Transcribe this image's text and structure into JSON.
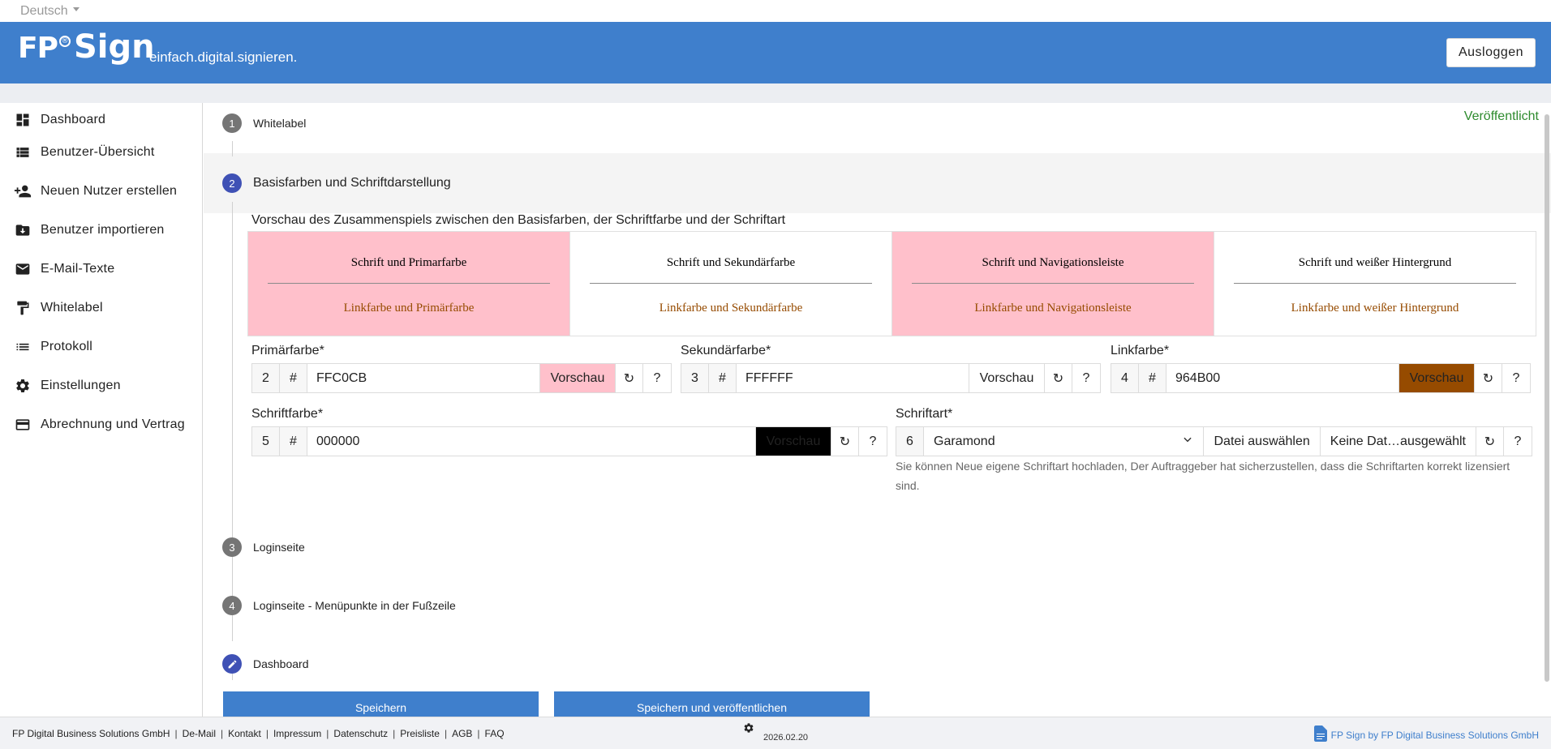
{
  "lang": {
    "label": "Deutsch"
  },
  "header": {
    "logo_fp": "FP",
    "logo_mark": "®",
    "logo_sign": "Sign",
    "tagline": "einfach.digital.signieren.",
    "logout": "Ausloggen"
  },
  "sidebar": {
    "items": [
      {
        "label": "Dashboard",
        "icon": "dashboard-icon"
      },
      {
        "label": "Benutzer-Übersicht",
        "icon": "list-icon"
      },
      {
        "label": "Neuen Nutzer erstellen",
        "icon": "person-add-icon"
      },
      {
        "label": "Benutzer importieren",
        "icon": "import-icon"
      },
      {
        "label": "E-Mail-Texte",
        "icon": "mail-icon"
      },
      {
        "label": "Whitelabel",
        "icon": "paint-roller-icon"
      },
      {
        "label": "Protokoll",
        "icon": "protocol-icon"
      },
      {
        "label": "Einstellungen",
        "icon": "gear-icon"
      },
      {
        "label": "Abrechnung und Vertrag",
        "icon": "credit-card-icon"
      }
    ]
  },
  "main": {
    "status": "Veröffentlicht",
    "steps": [
      {
        "num": "1",
        "label": "Whitelabel"
      },
      {
        "num": "2",
        "label": "Basisfarben und Schriftdarstellung"
      },
      {
        "num": "3",
        "label": "Loginseite"
      },
      {
        "num": "4",
        "label": "Loginseite - Menüpunkte in der Fußzeile"
      },
      {
        "num": "",
        "label": "Dashboard"
      }
    ],
    "preview_title": "Vorschau des Zusammenspiels zwischen den Basisfarben, der Schriftfarbe und der Schriftart",
    "preview_cells": [
      {
        "top": "Schrift und Primarfarbe",
        "bottom": "Linkfarbe und Primärfarbe",
        "bg": "#FFC0CB"
      },
      {
        "top": "Schrift und Sekundärfarbe",
        "bottom": "Linkfarbe und Sekundärfarbe",
        "bg": "#FFFFFF"
      },
      {
        "top": "Schrift und Navigationsleiste",
        "bottom": "Linkfarbe und Navigationsleiste",
        "bg": "#FFC0CB"
      },
      {
        "top": "Schrift und weißer Hintergrund",
        "bottom": "Linkfarbe und weißer Hintergrund",
        "bg": "#FFFFFF"
      }
    ],
    "fields": {
      "primary": {
        "label": "Primärfarbe*",
        "num": "2",
        "hash": "#",
        "value": "FFC0CB",
        "preview": "Vorschau",
        "reset": "↻",
        "help": "?",
        "color": "#FFC0CB"
      },
      "secondary": {
        "label": "Sekundärfarbe*",
        "num": "3",
        "hash": "#",
        "value": "FFFFFF",
        "preview": "Vorschau",
        "reset": "↻",
        "help": "?",
        "color": "#FFFFFF"
      },
      "link": {
        "label": "Linkfarbe*",
        "num": "4",
        "hash": "#",
        "value": "964B00",
        "preview": "Vorschau",
        "reset": "↻",
        "help": "?",
        "color": "#964B00"
      },
      "font_color": {
        "label": "Schriftfarbe*",
        "num": "5",
        "hash": "#",
        "value": "000000",
        "preview": "Vorschau",
        "reset": "↻",
        "help": "?",
        "color": "#000000"
      },
      "font": {
        "label": "Schriftart*",
        "num": "6",
        "value": "Garamond",
        "file_button": "Datei auswählen",
        "file_status": "Keine Dat…ausgewählt",
        "reset": "↻",
        "help": "?"
      }
    },
    "font_hint": "Sie können Neue eigene Schriftart hochladen, Der Auftraggeber hat sicherzustellen, dass die Schriftarten korrekt lizensiert sind.",
    "save": "Speichern",
    "save_publish": "Speichern und veröffentlichen"
  },
  "footer": {
    "links": [
      "FP Digital Business Solutions GmbH",
      "De-Mail",
      "Kontakt",
      "Impressum",
      "Datenschutz",
      "Preisliste",
      "AGB",
      "FAQ"
    ],
    "version": "2026.02.20",
    "brand": "FP Sign by FP Digital Business Solutions GmbH"
  },
  "colors": {
    "header": "#3f7fcc",
    "step_active": "#3f51b5",
    "status": "#2e8b2e"
  }
}
